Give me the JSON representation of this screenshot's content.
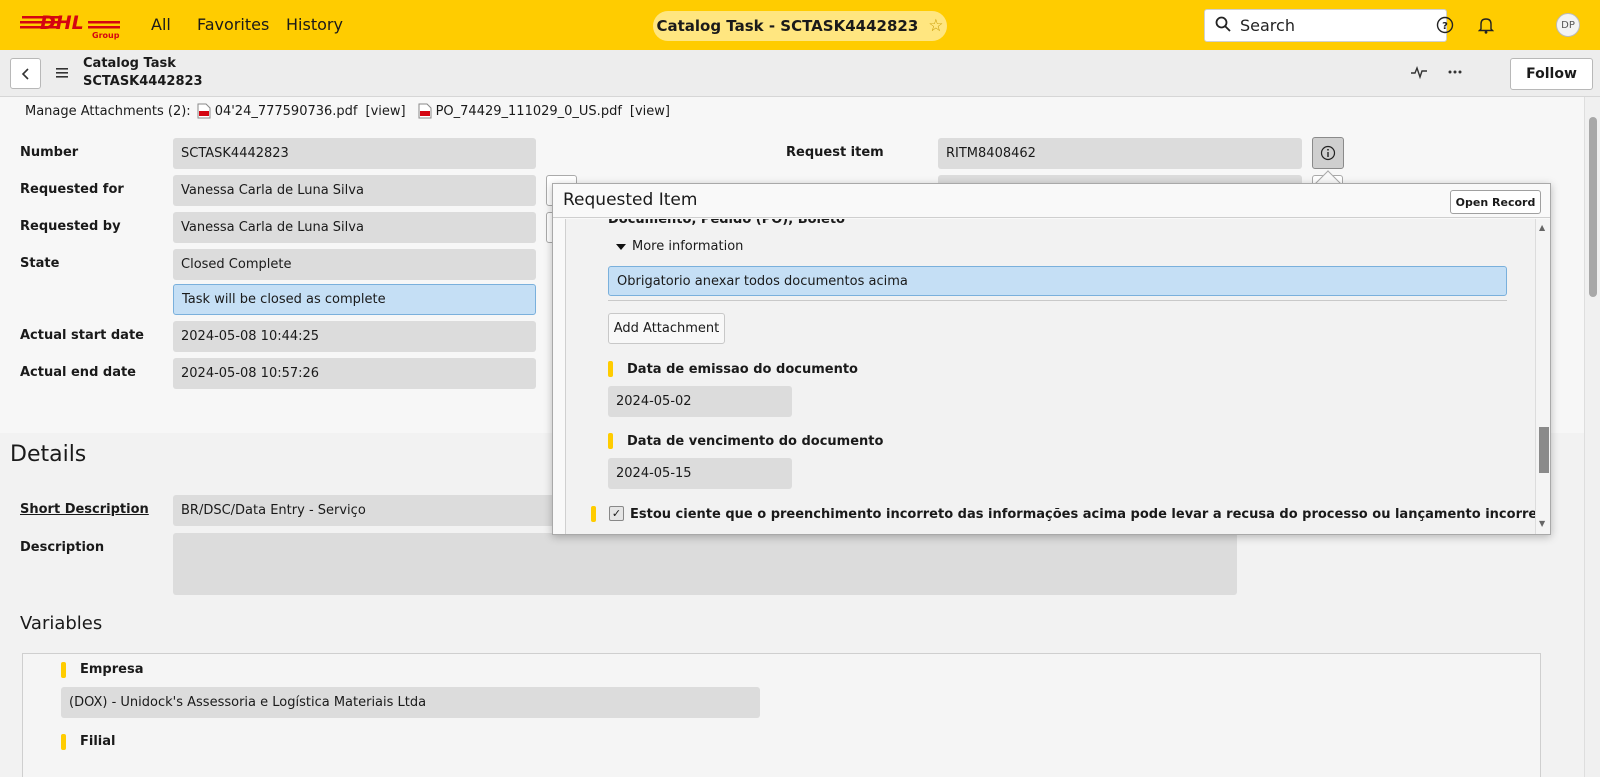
{
  "nav": {
    "logo_text": "DHL",
    "logo_sub": "Group",
    "links": [
      "All",
      "Favorites",
      "History"
    ],
    "title": "Catalog Task - SCTASK4442823",
    "search_placeholder": "Search",
    "avatar_initials": "DP"
  },
  "header": {
    "record_type": "Catalog Task",
    "record_number": "SCTASK4442823",
    "follow_label": "Follow"
  },
  "attachments": {
    "label": "Manage Attachments (2):",
    "files": [
      {
        "name": "04'24_777590736.pdf",
        "view": "[view]"
      },
      {
        "name": "PO_74429_111029_0_US.pdf",
        "view": "[view]"
      }
    ]
  },
  "form": {
    "number_label": "Number",
    "number_value": "SCTASK4442823",
    "requested_for_label": "Requested for",
    "requested_for_value": "Vanessa Carla de Luna Silva",
    "requested_by_label": "Requested by",
    "requested_by_value": "Vanessa Carla de Luna Silva",
    "state_label": "State",
    "state_value": "Closed Complete",
    "state_hint": "Task will be closed as complete",
    "start_label": "Actual start date",
    "start_value": "2024-05-08 10:44:25",
    "end_label": "Actual end date",
    "end_value": "2024-05-08 10:57:26",
    "request_item_label": "Request item",
    "request_item_value": "RITM8408462"
  },
  "details": {
    "title": "Details",
    "short_desc_label": "Short Description",
    "short_desc_value": "BR/DSC/Data Entry - Serviço",
    "desc_label": "Description",
    "desc_value": ""
  },
  "variables": {
    "title": "Variables",
    "empresa_label": "Empresa",
    "empresa_value": "(DOX) - Unidock's Assessoria e Logística Materiais Ltda",
    "filial_label": "Filial"
  },
  "popover": {
    "title": "Requested Item",
    "open_record_label": "Open Record",
    "partial_heading": "Documento, Pedido (PO), Boleto",
    "more_info_label": "More information",
    "info_text": "Obrigatorio anexar todos documentos acima",
    "add_attachment_label": "Add Attachment",
    "emissao_label": "Data de emissao do documento",
    "emissao_value": "2024-05-02",
    "vencimento_label": "Data de vencimento do documento",
    "vencimento_value": "2024-05-15",
    "checkbox_label": "Estou ciente que o preenchimento incorreto das informações acima pode levar a recusa do processo ou lançamento incorreto",
    "checkbox_checked": true
  },
  "colors": {
    "brand_yellow": "#ffcc00",
    "brand_red": "#d40511"
  }
}
